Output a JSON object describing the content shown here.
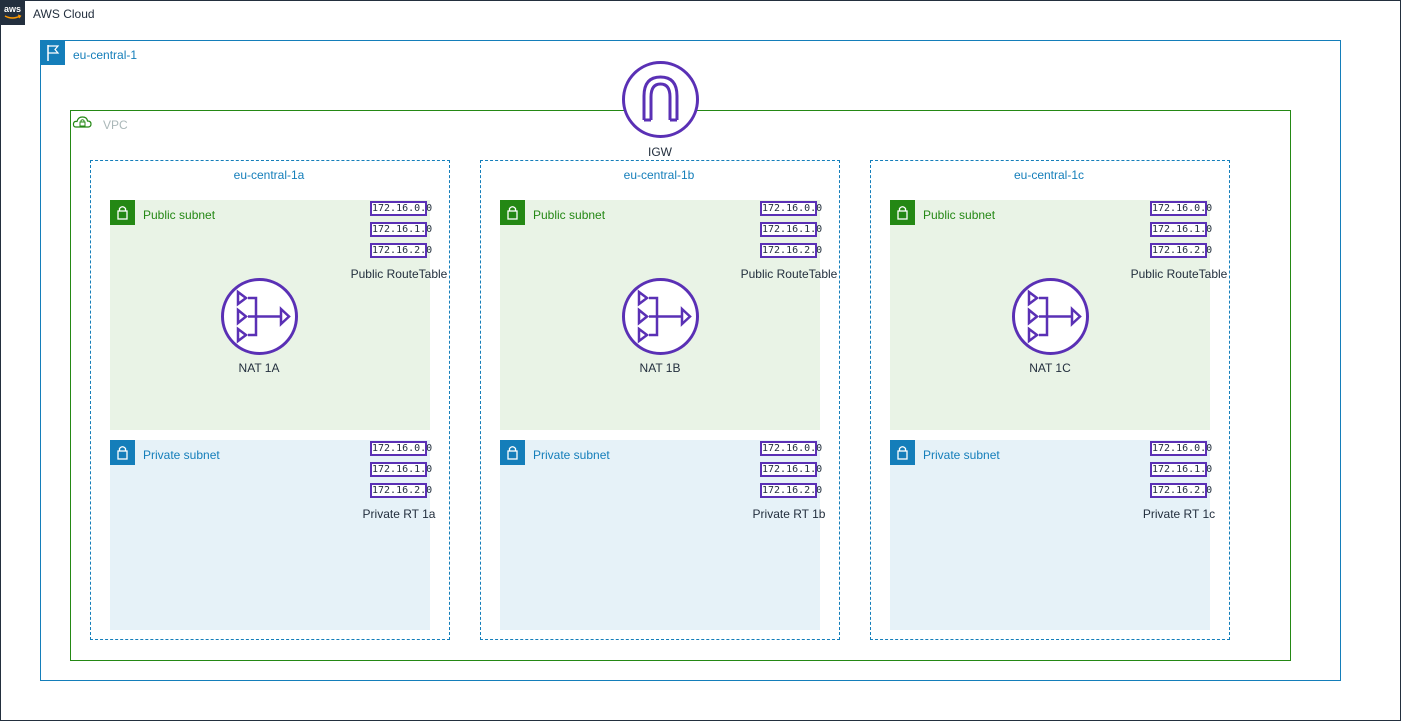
{
  "cloud": {
    "label": "AWS Cloud",
    "icon": "aws-logo-icon"
  },
  "region": {
    "label": "eu-central-1",
    "icon": "region-flag-icon"
  },
  "vpc": {
    "label": "VPC",
    "icon": "vpc-cloud-lock-icon"
  },
  "igw": {
    "label": "IGW",
    "icon": "internet-gateway-icon"
  },
  "colors": {
    "cloud_border": "#232f3e",
    "region": "#147eba",
    "vpc": "#248814",
    "public_fill": "#e9f3e6",
    "private_fill": "#e6f2f8",
    "resource_purple": "#5a30b5"
  },
  "azs": [
    {
      "label": "eu-central-1a",
      "public_subnet": {
        "label": "Public subnet",
        "routes": [
          "172.16.0.0",
          "172.16.1.0",
          "172.16.2.0"
        ],
        "route_table": "Public RouteTable",
        "nat": "NAT 1A"
      },
      "private_subnet": {
        "label": "Private subnet",
        "routes": [
          "172.16.0.0",
          "172.16.1.0",
          "172.16.2.0"
        ],
        "route_table": "Private RT 1a"
      }
    },
    {
      "label": "eu-central-1b",
      "public_subnet": {
        "label": "Public subnet",
        "routes": [
          "172.16.0.0",
          "172.16.1.0",
          "172.16.2.0"
        ],
        "route_table": "Public RouteTable",
        "nat": "NAT 1B"
      },
      "private_subnet": {
        "label": "Private subnet",
        "routes": [
          "172.16.0.0",
          "172.16.1.0",
          "172.16.2.0"
        ],
        "route_table": "Private RT 1b"
      }
    },
    {
      "label": "eu-central-1c",
      "public_subnet": {
        "label": "Public subnet",
        "routes": [
          "172.16.0.0",
          "172.16.1.0",
          "172.16.2.0"
        ],
        "route_table": "Public RouteTable",
        "nat": "NAT 1C"
      },
      "private_subnet": {
        "label": "Private subnet",
        "routes": [
          "172.16.0.0",
          "172.16.1.0",
          "172.16.2.0"
        ],
        "route_table": "Private RT 1c"
      }
    }
  ]
}
